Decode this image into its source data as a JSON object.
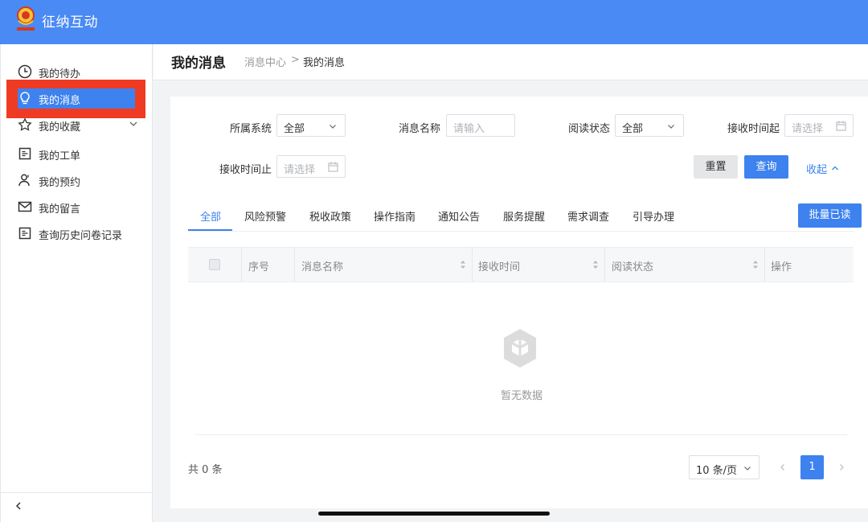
{
  "app": {
    "title": "征纳互动"
  },
  "sidebar": {
    "items": [
      {
        "label": "我的待办",
        "icon": "clock-icon"
      },
      {
        "label": "我的消息",
        "icon": "lightbulb-icon",
        "active": true
      },
      {
        "label": "我的收藏",
        "icon": "star-icon",
        "expandable": true
      },
      {
        "label": "我的工单",
        "icon": "workorder-icon"
      },
      {
        "label": "我的预约",
        "icon": "user-icon"
      },
      {
        "label": "我的留言",
        "icon": "mail-icon"
      },
      {
        "label": "查询历史问卷记录",
        "icon": "document-icon"
      }
    ],
    "collapse_icon": "chevron-left-icon"
  },
  "header": {
    "title": "我的消息",
    "breadcrumb": [
      "消息中心",
      ">",
      "我的消息"
    ]
  },
  "filters": {
    "system": {
      "label": "所属系统",
      "value": "全部"
    },
    "name": {
      "label": "消息名称",
      "placeholder": "请输入"
    },
    "status": {
      "label": "阅读状态",
      "value": "全部"
    },
    "time_from": {
      "label": "接收时间起",
      "placeholder": "请选择"
    },
    "time_to": {
      "label": "接收时间止",
      "placeholder": "请选择"
    },
    "reset_label": "重置",
    "query_label": "查询",
    "collapse_label": "收起"
  },
  "tabs": [
    {
      "label": "全部",
      "active": true
    },
    {
      "label": "风险预警"
    },
    {
      "label": "税收政策"
    },
    {
      "label": "操作指南"
    },
    {
      "label": "通知公告"
    },
    {
      "label": "服务提醒"
    },
    {
      "label": "需求调查"
    },
    {
      "label": "引导办理"
    }
  ],
  "batch_read_label": "批量已读",
  "table": {
    "columns": [
      "序号",
      "消息名称",
      "接收时间",
      "阅读状态",
      "操作"
    ],
    "rows": [],
    "empty_text": "暂无数据"
  },
  "pagination": {
    "total_text": "共 0 条",
    "page_size": "10 条/页",
    "current_page": "1"
  },
  "colors": {
    "topbar": "#4a8af4",
    "primary": "#3d82ee",
    "highlight": "#ef3b24"
  }
}
